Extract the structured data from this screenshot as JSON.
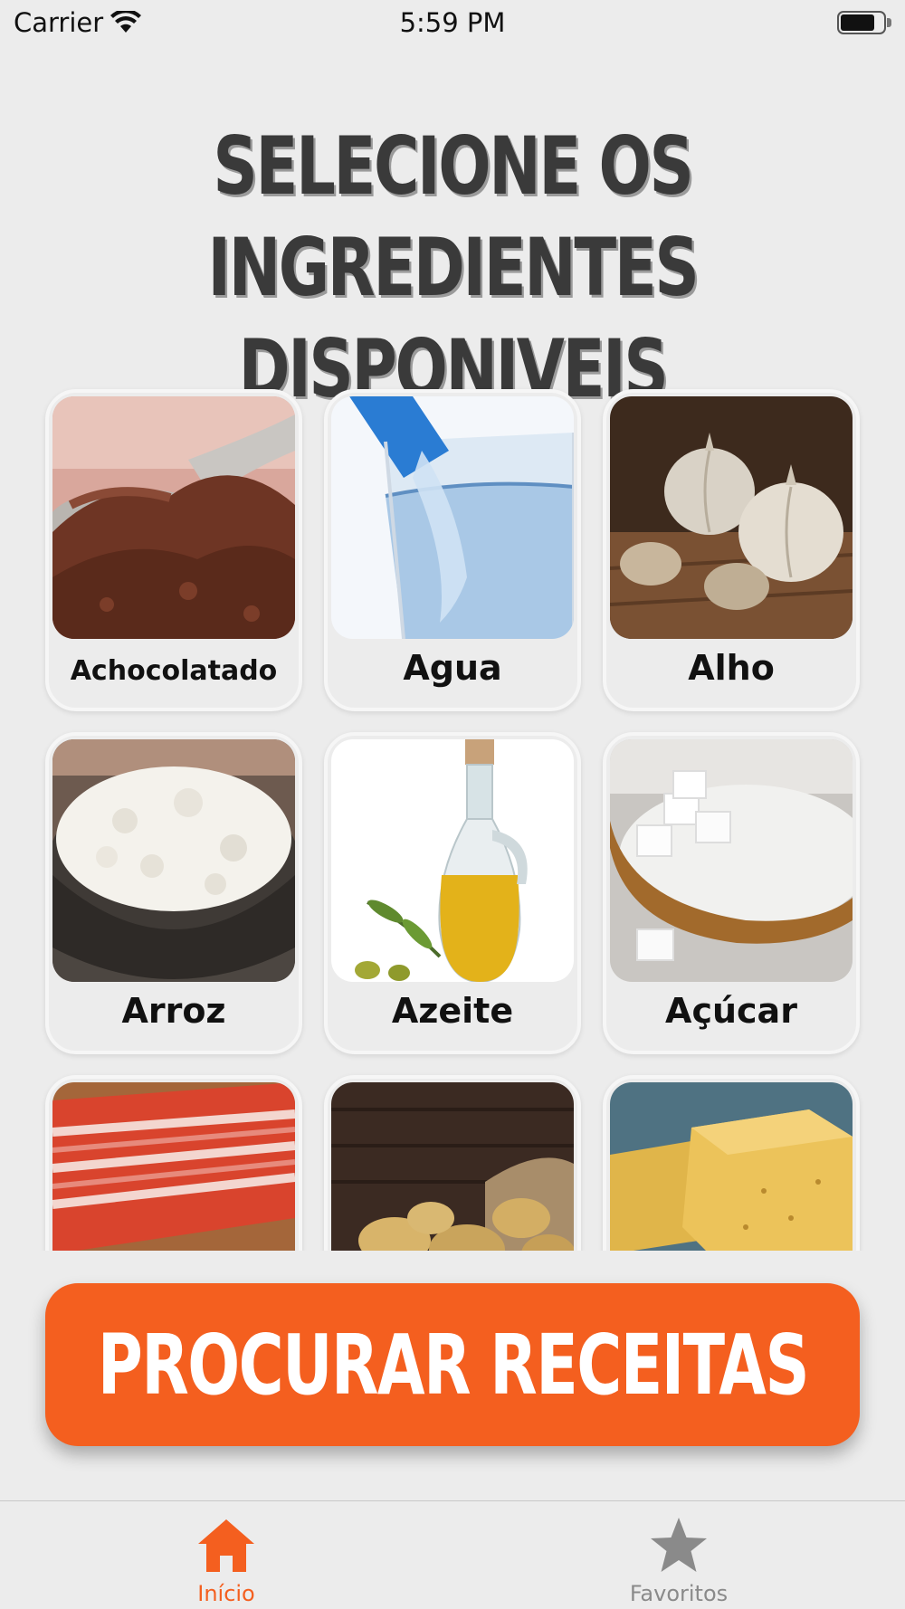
{
  "status_bar": {
    "carrier": "Carrier",
    "time": "5:59 PM",
    "battery_level": 0.8
  },
  "headline": {
    "line1": "SELECIONE OS INGREDIENTES",
    "line2": "DISPONIVEIS"
  },
  "ingredients": [
    {
      "label": "Achocolatado",
      "icon": "cocoa-powder-photo"
    },
    {
      "label": "Agua",
      "icon": "water-glass-photo"
    },
    {
      "label": "Alho",
      "icon": "garlic-photo"
    },
    {
      "label": "Arroz",
      "icon": "rice-bowl-photo"
    },
    {
      "label": "Azeite",
      "icon": "olive-oil-photo"
    },
    {
      "label": "Açúcar",
      "icon": "sugar-photo"
    },
    {
      "label": "",
      "icon": "bacon-photo"
    },
    {
      "label": "",
      "icon": "potatoes-photo"
    },
    {
      "label": "",
      "icon": "bouillon-cube-photo"
    }
  ],
  "search_button": {
    "label": "PROCURAR RECEITAS"
  },
  "tabbar": {
    "tabs": [
      {
        "label": "Início",
        "icon": "home-icon",
        "active": true
      },
      {
        "label": "Favoritos",
        "icon": "star-icon",
        "active": false
      }
    ]
  },
  "colors": {
    "accent": "#f45f1f",
    "background": "#ececec",
    "headline": "#3a3a3a",
    "inactive_tab": "#8a8a8a"
  }
}
